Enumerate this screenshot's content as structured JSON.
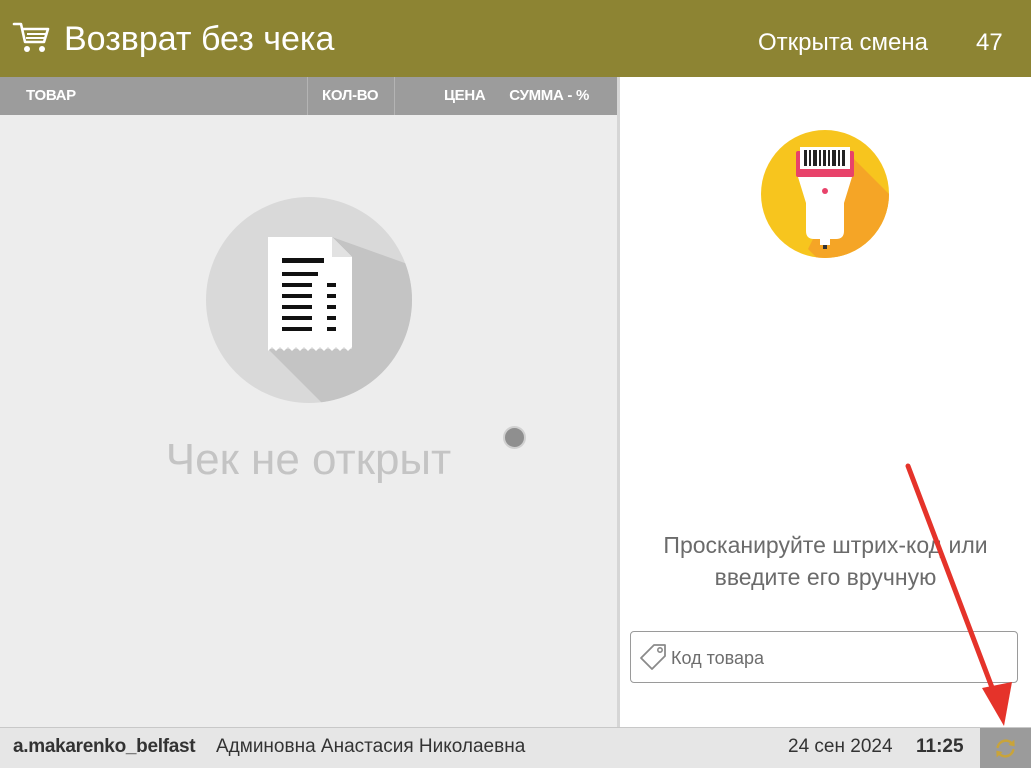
{
  "header": {
    "title": "Возврат без чека",
    "shift_label": "Открыта смена",
    "shift_number": "47",
    "icon": "cart-icon"
  },
  "receipt": {
    "columns": {
      "item": "ТОВАР",
      "qty": "КОЛ-ВО",
      "price": "ЦЕНА",
      "sum": "СУММА - %"
    },
    "empty_icon": "receipt-icon",
    "empty_text": "Чек не открыт"
  },
  "scan": {
    "icon": "barcode-scanner-icon",
    "prompt_line1": "Просканируйте штрих-код или",
    "prompt_line2": "введите его вручную",
    "input_placeholder": "Код товара",
    "input_value": "",
    "input_icon": "tag-icon"
  },
  "footer": {
    "login": "a.makarenko_belfast",
    "full_name": "Админовна Анастасия Николаевна",
    "date": "24 сен 2024",
    "time": "11:25",
    "sync_icon": "sync-icon"
  },
  "colors": {
    "header_bg": "#8d8433",
    "column_header_bg": "#9c9c9c",
    "panel_bg": "#ededed",
    "scanner_yellow": "#f7c51e",
    "annotation_arrow": "#e5332a"
  }
}
